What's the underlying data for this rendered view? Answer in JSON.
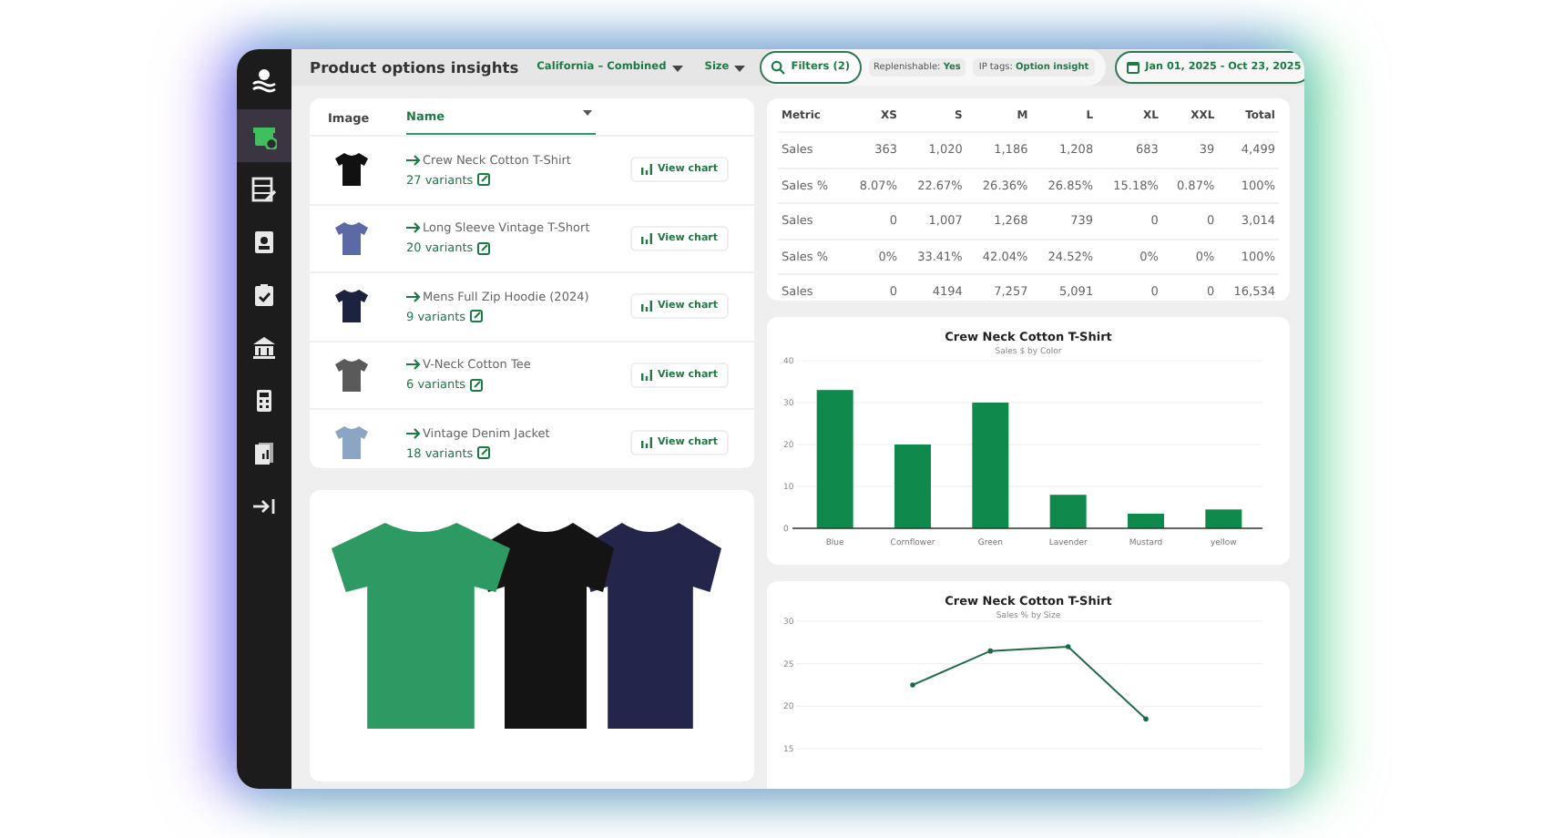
{
  "sidebar": {
    "items": [
      {
        "selected": true
      },
      {
        "selected": false
      },
      {
        "selected": false
      },
      {
        "selected": false
      },
      {
        "selected": false
      },
      {
        "selected": false
      },
      {
        "selected": false
      },
      {
        "selected": false
      }
    ]
  },
  "header": {
    "title": "Product options insights",
    "location_filter": "California – Combined",
    "size_filter": "Size",
    "filters_button": "Filters (2)",
    "chips": [
      {
        "label": "Replenishable:",
        "value": "Yes"
      },
      {
        "label": "IP tags:",
        "value": "Option insight"
      }
    ],
    "date_range": "Jan 01, 2025 - Oct 23, 2025"
  },
  "products": {
    "columns": [
      "Image",
      "Name"
    ],
    "rows": [
      {
        "color": "#111111",
        "name": "Crew Neck Cotton T-Shirt",
        "variants": "27 variants",
        "button": "View chart"
      },
      {
        "color": "#5b6aa6",
        "name": "Long Sleeve Vintage T-Short",
        "variants": "20 variants",
        "button": "View chart"
      },
      {
        "color": "#1c2340",
        "name": "Mens Full Zip Hoodie (2024)",
        "variants": "9 variants",
        "button": "View chart"
      },
      {
        "color": "#5a5a5a",
        "name": "V-Neck Cotton Tee",
        "variants": "6 variants",
        "button": "View chart"
      },
      {
        "color": "#8aa6c4",
        "name": "Vintage Denim Jacket",
        "variants": "18 variants",
        "button": "View chart"
      }
    ]
  },
  "metrics": {
    "columns": [
      "Metric",
      "XS",
      "S",
      "M",
      "L",
      "XL",
      "XXL",
      "Total"
    ],
    "rows": [
      [
        "Sales",
        "363",
        "1,020",
        "1,186",
        "1,208",
        "683",
        "39",
        "4,499"
      ],
      [
        "Sales %",
        "8.07%",
        "22.67%",
        "26.36%",
        "26.85%",
        "15.18%",
        "0.87%",
        "100%"
      ],
      [
        "Sales",
        "0",
        "1,007",
        "1,268",
        "739",
        "0",
        "0",
        "3,014"
      ],
      [
        "Sales %",
        "0%",
        "33.41%",
        "42.04%",
        "24.52%",
        "0%",
        "0%",
        "100%"
      ],
      [
        "Sales",
        "0",
        "4194",
        "7,257",
        "5,091",
        "0",
        "0",
        "16,534"
      ]
    ]
  },
  "bar_chart": {
    "chart_data": {
      "type": "bar",
      "title": "Crew Neck Cotton T-Shirt",
      "subtitle": "Sales $ by Color",
      "categories": [
        "Blue",
        "Cornflower",
        "Green",
        "Lavender",
        "Mustard",
        "yellow"
      ],
      "values": [
        33,
        20,
        30,
        8,
        3.5,
        4.5
      ],
      "ylim": [
        0,
        40
      ],
      "yticks": [
        0,
        10,
        20,
        30,
        40
      ],
      "grid": true
    }
  },
  "line_chart": {
    "chart_data": {
      "type": "line",
      "title": "Crew Neck Cotton T-Shirt",
      "subtitle": "Sales % by Size",
      "values": [
        null,
        22.5,
        26.5,
        27,
        18.5,
        null
      ],
      "ylim": [
        15,
        30
      ],
      "yticks": [
        15,
        20,
        25,
        30
      ],
      "grid": true
    }
  },
  "photo": {
    "shirts": [
      {
        "color": "#2e9a63"
      },
      {
        "color": "#141414"
      },
      {
        "color": "#23254a"
      }
    ]
  }
}
